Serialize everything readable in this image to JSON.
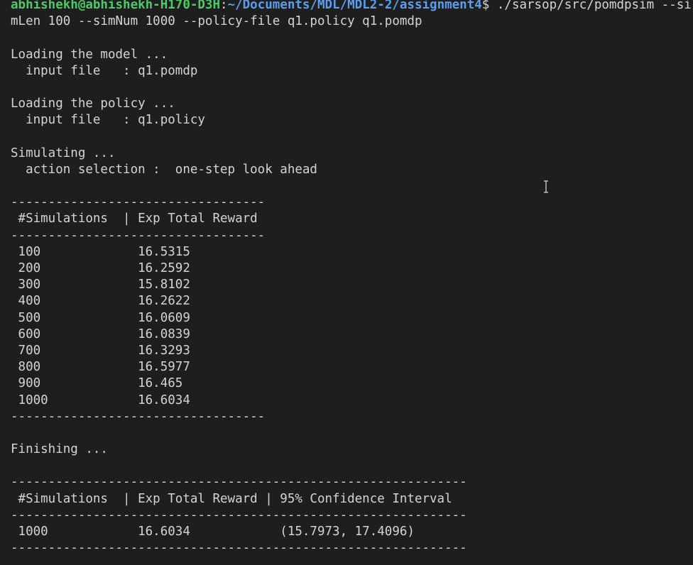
{
  "prompt": {
    "user_host": "abhishekh@abhishekh-H170-D3H",
    "colon": ":",
    "path": "~/Documents/MDL/MDL2-2/assignment4",
    "dollar": "$ ",
    "command_line1": "./sarsop/src/pomdpsim --si",
    "command_line2": "mLen 100 --simNum 1000 --policy-file q1.policy q1.pomdp"
  },
  "output": {
    "loading_model": "Loading the model ...",
    "model_input": "  input file   : q1.pomdp",
    "loading_policy": "Loading the policy ...",
    "policy_input": "  input file   : q1.policy",
    "simulating": "Simulating ...",
    "action_selection": "  action selection :  one-step look ahead",
    "table1_sep": "----------------------------------",
    "table1_header": " #Simulations  | Exp Total Reward",
    "table1_rows": [
      " 100             16.5315",
      " 200             16.2592",
      " 300             15.8102",
      " 400             16.2622",
      " 500             16.0609",
      " 600             16.0839",
      " 700             16.3293",
      " 800             16.5977",
      " 900             16.465",
      " 1000            16.6034"
    ],
    "finishing": "Finishing ...",
    "table2_sep": "-------------------------------------------------------------",
    "table2_header": " #Simulations  | Exp Total Reward | 95% Confidence Interval",
    "table2_row": " 1000            16.6034            (15.7973, 17.4096)"
  }
}
